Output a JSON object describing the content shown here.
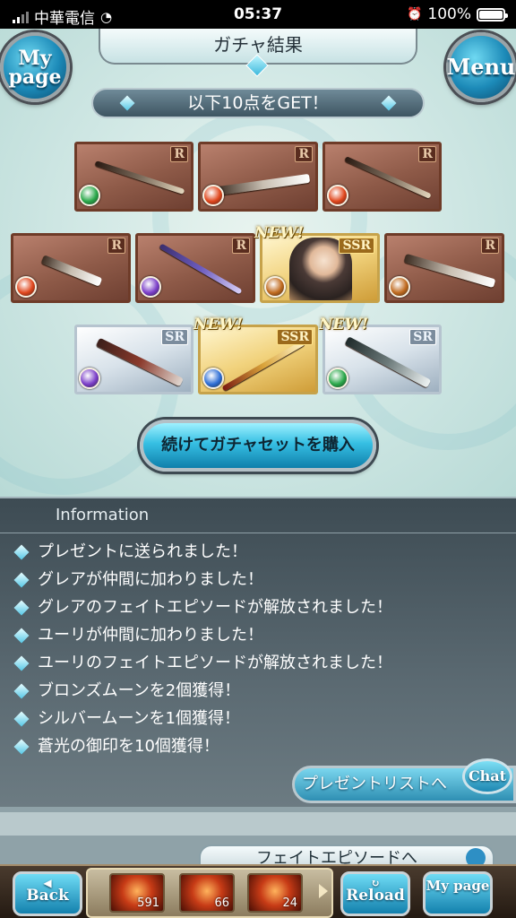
{
  "status": {
    "carrier": "中華電信",
    "time": "05:37",
    "battery": "100%",
    "battery_level": 1.0
  },
  "header": {
    "mypage_label": "My page",
    "title": "ガチャ結果",
    "menu_label": "Menu"
  },
  "get_banner": "以下10点をGET！",
  "cards": [
    {
      "rarity": "R",
      "element": "wind",
      "kind": "weapon",
      "new": false
    },
    {
      "rarity": "R",
      "element": "fire",
      "kind": "weapon",
      "new": false
    },
    {
      "rarity": "R",
      "element": "fire",
      "kind": "weapon",
      "new": false
    },
    {
      "rarity": "R",
      "element": "fire",
      "kind": "weapon",
      "new": false
    },
    {
      "rarity": "R",
      "element": "dark",
      "kind": "weapon",
      "new": false
    },
    {
      "rarity": "SSR",
      "element": "earth",
      "kind": "character",
      "new": true
    },
    {
      "rarity": "R",
      "element": "earth",
      "kind": "weapon",
      "new": false
    },
    {
      "rarity": "SR",
      "element": "dark",
      "kind": "weapon",
      "new": false
    },
    {
      "rarity": "SSR",
      "element": "water",
      "kind": "weapon",
      "new": true
    },
    {
      "rarity": "SR",
      "element": "wind",
      "kind": "weapon",
      "new": true
    }
  ],
  "new_label": "NEW!",
  "buy_button": "続けてガチャセットを購入",
  "info": {
    "title": "Information",
    "items": [
      "プレゼントに送られました！",
      "グレアが仲間に加わりました！",
      "グレアのフェイトエピソードが解放されました！",
      "ユーリが仲間に加わりました！",
      "ユーリのフェイトエピソードが解放されました！",
      "ブロンズムーンを2個獲得！",
      "シルバームーンを1個獲得！",
      "蒼光の御印を10個獲得！"
    ],
    "present_button": "プレゼントリストへ",
    "chat_label": "Chat"
  },
  "fate_button": "フェイトエピソードへ",
  "bottom": {
    "back_label": "Back",
    "reload_label": "Reload",
    "mypage_label": "My page",
    "items": [
      {
        "count": "591"
      },
      {
        "count": "66"
      },
      {
        "count": "24"
      }
    ]
  },
  "colors": {
    "wind": "#2aa84a",
    "fire": "#e0461c",
    "dark": "#7b3ec9",
    "earth": "#c06a1e",
    "water": "#2f6fd6"
  }
}
